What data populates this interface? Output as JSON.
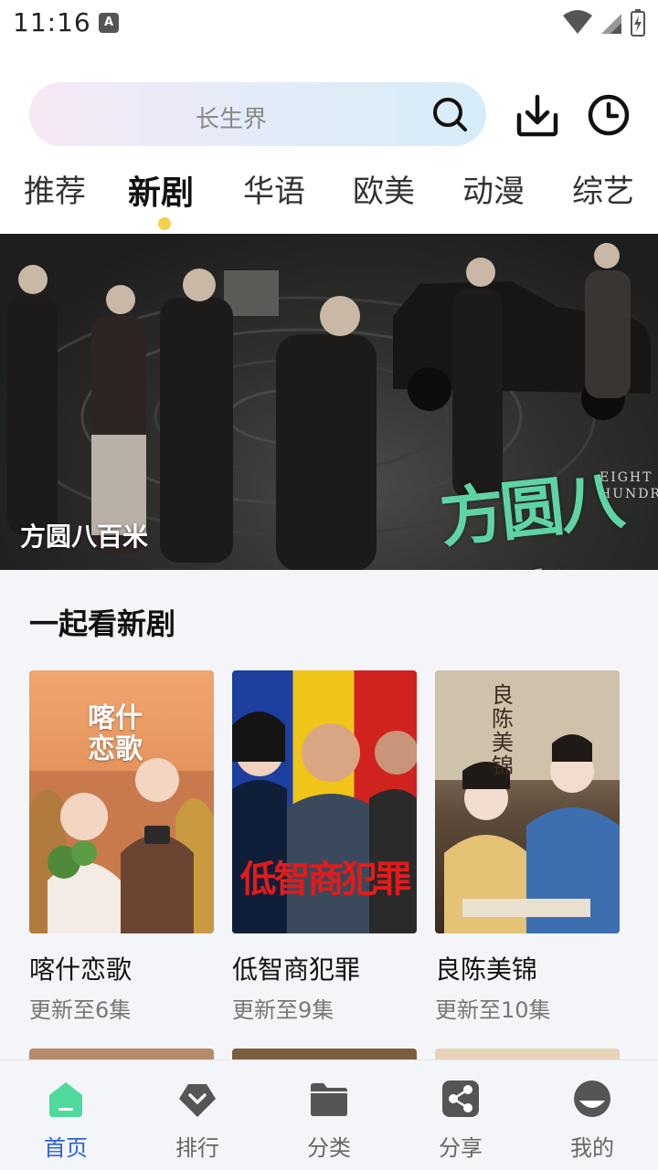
{
  "status_bar": {
    "time": "11:16",
    "notification_icon": "A"
  },
  "search": {
    "placeholder": "长生界"
  },
  "tabs": [
    {
      "label": "推荐",
      "active": false
    },
    {
      "label": "新剧",
      "active": true
    },
    {
      "label": "华语",
      "active": false
    },
    {
      "label": "欧美",
      "active": false
    },
    {
      "label": "动漫",
      "active": false
    },
    {
      "label": "综艺",
      "active": false
    }
  ],
  "banner": {
    "caption": "方圆八百米",
    "logo_text": "方圆八百米",
    "logo_en_line1": "EIGHT",
    "logo_en_line2": "HUNDRE"
  },
  "section": {
    "title": "一起看新剧"
  },
  "shows": [
    {
      "title": "喀什恋歌",
      "status": "更新至6集",
      "poster_text": "喀什恋歌"
    },
    {
      "title": "低智商犯罪",
      "status": "更新至9集",
      "poster_text": "低智商犯罪"
    },
    {
      "title": "良陈美锦",
      "status": "更新至10集",
      "poster_text": "良陈美锦"
    }
  ],
  "bottom_nav": [
    {
      "label": "首页",
      "icon": "home-icon",
      "active": true
    },
    {
      "label": "排行",
      "icon": "ranking-icon",
      "active": false
    },
    {
      "label": "分类",
      "icon": "folder-icon",
      "active": false
    },
    {
      "label": "分享",
      "icon": "share-icon",
      "active": false
    },
    {
      "label": "我的",
      "icon": "profile-icon",
      "active": false
    }
  ],
  "colors": {
    "accent": "#2b5fe0",
    "tab_indicator": "#f5cf4e",
    "home_icon": "#4fd99b"
  }
}
